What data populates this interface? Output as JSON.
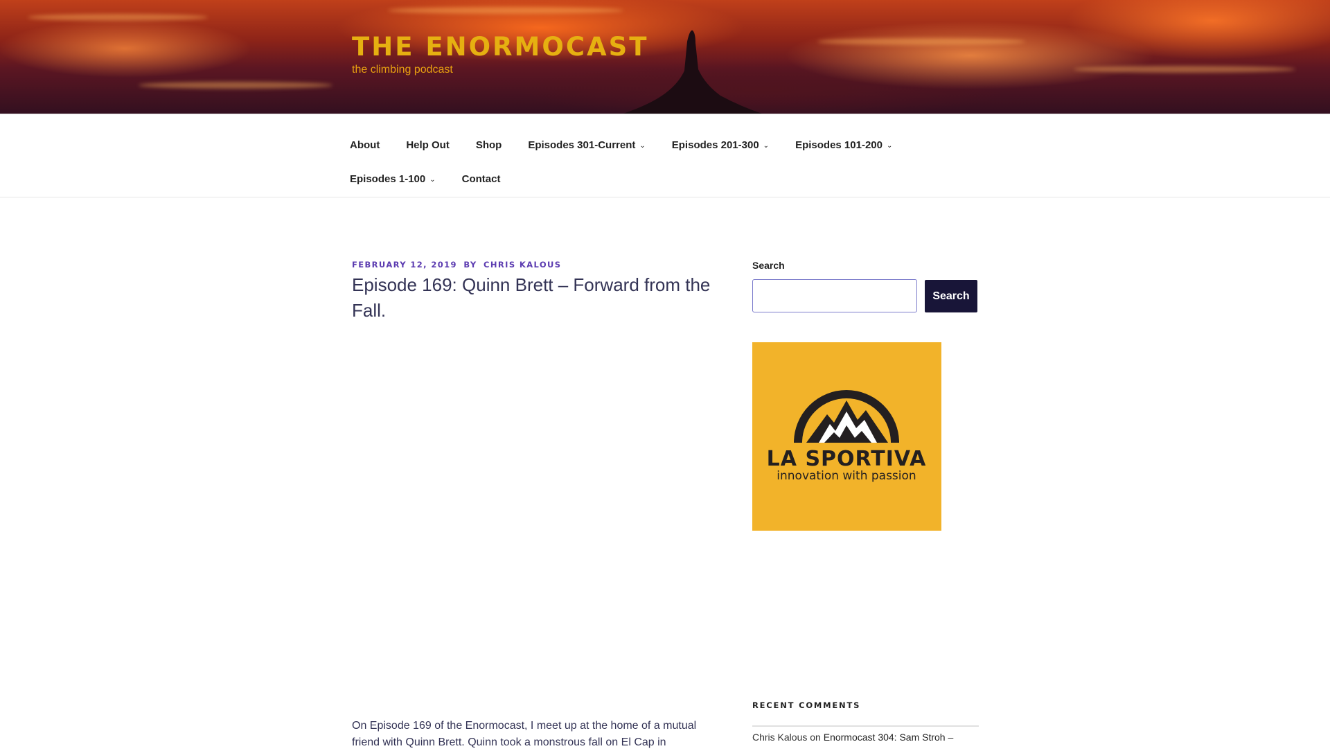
{
  "site": {
    "title": "THE ENORMOCAST",
    "tagline": "the climbing podcast"
  },
  "nav": {
    "row1": [
      {
        "label": "About",
        "has_children": false
      },
      {
        "label": "Help Out",
        "has_children": false
      },
      {
        "label": "Shop",
        "has_children": false
      },
      {
        "label": "Episodes 301-Current",
        "has_children": true
      },
      {
        "label": "Episodes 201-300",
        "has_children": true
      },
      {
        "label": "Episodes 101-200",
        "has_children": true
      }
    ],
    "row2": [
      {
        "label": "Episodes 1-100",
        "has_children": true
      },
      {
        "label": "Contact",
        "has_children": false
      }
    ],
    "chevron": "⌄"
  },
  "post": {
    "date": "FEBRUARY 12, 2019",
    "by": "BY",
    "author": "CHRIS KALOUS",
    "title": "Episode 169: Quinn Brett – Forward from the Fall.",
    "excerpt": "On Episode 169 of the Enormocast, I meet up at the home of a mutual friend with Quinn Brett. Quinn took a monstrous fall on El Cap in"
  },
  "sidebar": {
    "search_label": "Search",
    "search_placeholder": "",
    "search_button": "Search",
    "ad": {
      "brand": "LA SPORTIVA",
      "slogan": "innovation with passion",
      "background": "#f2b32a"
    },
    "recent_comments": {
      "title": "RECENT COMMENTS",
      "items": [
        {
          "author": "Chris Kalous",
          "connector": "on",
          "post": "Enormocast 304: Sam Stroh –"
        }
      ]
    }
  },
  "colors": {
    "title": "#e6b011",
    "meta": "#5b3bb0",
    "button": "#181538"
  }
}
